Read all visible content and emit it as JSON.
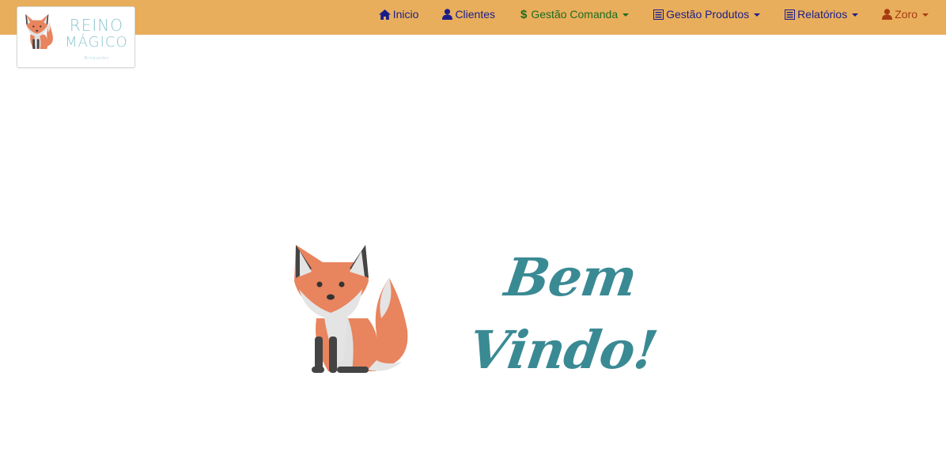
{
  "brand": {
    "name_line1": "REINO",
    "name_line2": "MÁGICO",
    "tagline": "Brinquedos"
  },
  "nav": {
    "items": [
      {
        "label": "Inicio",
        "icon": "home-icon",
        "color": "#1b1e8a",
        "dropdown": false
      },
      {
        "label": "Clientes",
        "icon": "user-icon",
        "color": "#1b1e8a",
        "dropdown": false
      },
      {
        "label": "Gestão Comanda",
        "icon": "dollar-icon",
        "color": "#1e6b1e",
        "dropdown": true
      },
      {
        "label": "Gestão Produtos",
        "icon": "list-icon",
        "color": "#1b1e8a",
        "dropdown": true
      },
      {
        "label": "Relatórios",
        "icon": "list-icon",
        "color": "#1b1e8a",
        "dropdown": true
      },
      {
        "label": "Zoro",
        "icon": "user-icon",
        "color": "#a63d12",
        "dropdown": true
      }
    ]
  },
  "main": {
    "welcome_line1": "Bem",
    "welcome_line2": "Vindo!"
  },
  "colors": {
    "navbar_bg": "#e9ae5c",
    "welcome_text": "#3a8a94",
    "logo_text": "#8cc5cf"
  }
}
